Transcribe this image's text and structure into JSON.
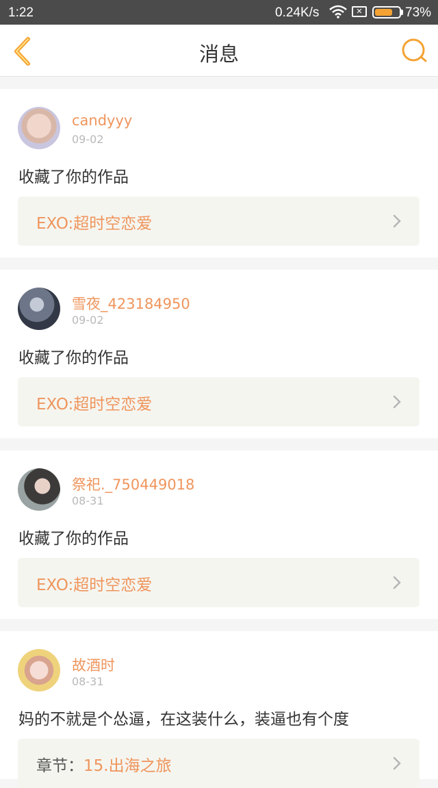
{
  "status_bar": {
    "time": "1:22",
    "network_speed": "0.24K/s",
    "wifi_icon": "wifi-icon",
    "sim_icon": "no-sim-icon",
    "battery_icon": "battery-icon",
    "battery_level": 0.73,
    "battery_percent": "73%",
    "battery_color": "#f4a233"
  },
  "header": {
    "title": "消息",
    "back_icon": "chevron-left-icon",
    "search_icon": "search-icon",
    "accent_color": "#f4a233"
  },
  "messages": [
    {
      "username": "candyyy",
      "date": "09-02",
      "text": "收藏了你的作品",
      "link_prefix": "",
      "link_text": "EXO:超时空恋爱"
    },
    {
      "username": "雪夜_423184950",
      "date": "09-02",
      "text": "收藏了你的作品",
      "link_prefix": "",
      "link_text": "EXO:超时空恋爱"
    },
    {
      "username": "祭祀._750449018",
      "date": "08-31",
      "text": "收藏了你的作品",
      "link_prefix": "",
      "link_text": "EXO:超时空恋爱"
    },
    {
      "username": "故酒时",
      "date": "08-31",
      "text": "妈的不就是个怂逼，在这装什么，装逼也有个度",
      "link_prefix": "章节：",
      "link_text": "15.出海之旅"
    }
  ],
  "colors": {
    "username": "#ef955c",
    "link": "#ef955c",
    "date": "#b9b9b9"
  }
}
